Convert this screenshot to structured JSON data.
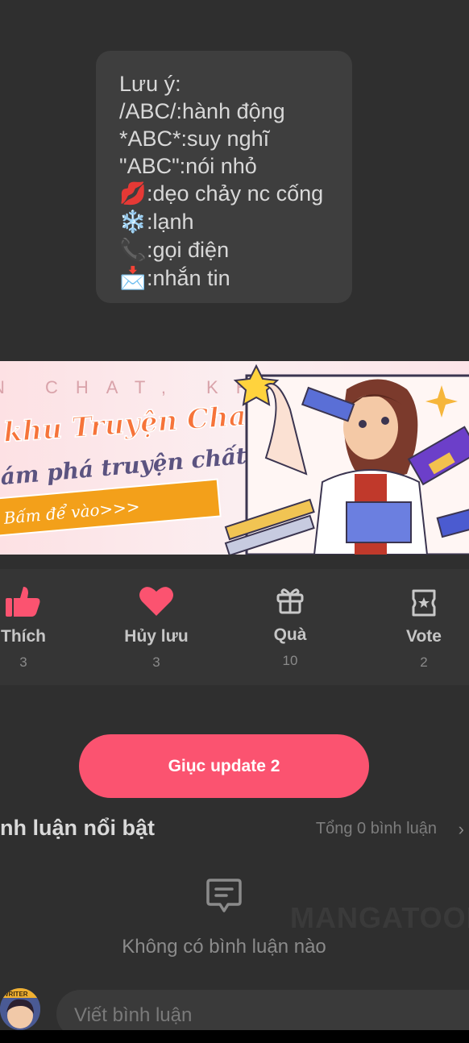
{
  "note": {
    "lines": [
      {
        "emoji": "",
        "text": "Lưu ý:"
      },
      {
        "emoji": "",
        "text": "/ABC/:hành động"
      },
      {
        "emoji": "",
        "text": "*ABC*:suy nghĩ"
      },
      {
        "emoji": "",
        "text": "\"ABC\":nói nhỏ"
      },
      {
        "emoji": "💋",
        "text": ":dẹo chảy nc cống"
      },
      {
        "emoji": "❄️",
        "text": ":lạnh"
      },
      {
        "emoji": "📞",
        "text": ":gọi điện"
      },
      {
        "emoji": "📩",
        "text": ":nhắn tin"
      }
    ]
  },
  "banner": {
    "top_text": "N CHAT, KHÁM PH",
    "title": "khu Truyện Chat,",
    "subtitle": "ám phá truyện chất",
    "button": "Bấm để vào>>>"
  },
  "actions": {
    "like": {
      "label": "Thích",
      "count": "3"
    },
    "save": {
      "label": "Hủy lưu",
      "count": "3"
    },
    "gift": {
      "label": "Quà",
      "count": "10"
    },
    "vote": {
      "label": "Vote",
      "count": "2"
    }
  },
  "update_button": "Giục update 2",
  "comments": {
    "title": "nh luận nổi bật",
    "total": "Tổng 0 bình luận",
    "empty": "Không có bình luận nào",
    "watermark": "MANGATOON",
    "input_placeholder": "Viết bình luận"
  },
  "avatar_badge": "WRITER",
  "colors": {
    "accent": "#fb5370",
    "background": "#2f2f2f",
    "card": "#3e3e3e"
  }
}
